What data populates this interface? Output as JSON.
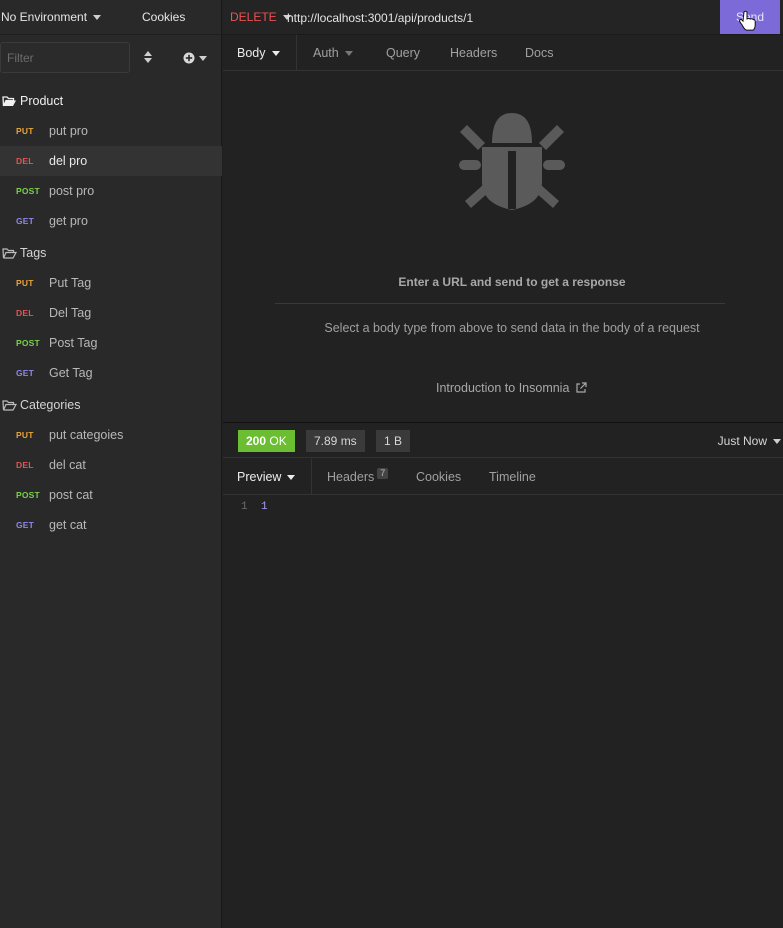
{
  "sidebar": {
    "environment": "No Environment",
    "cookies": "Cookies",
    "filter_placeholder": "Filter",
    "folders": [
      {
        "name": "Product",
        "requests": [
          {
            "method": "PUT",
            "name": "put pro"
          },
          {
            "method": "DEL",
            "name": "del pro"
          },
          {
            "method": "POST",
            "name": "post pro"
          },
          {
            "method": "GET",
            "name": "get pro"
          }
        ]
      },
      {
        "name": "Tags",
        "requests": [
          {
            "method": "PUT",
            "name": "Put Tag"
          },
          {
            "method": "DEL",
            "name": "Del Tag"
          },
          {
            "method": "POST",
            "name": "Post Tag"
          },
          {
            "method": "GET",
            "name": "Get Tag"
          }
        ]
      },
      {
        "name": "Categories",
        "requests": [
          {
            "method": "PUT",
            "name": "put categoies"
          },
          {
            "method": "DEL",
            "name": "del cat"
          },
          {
            "method": "POST",
            "name": "post cat"
          },
          {
            "method": "GET",
            "name": "get cat"
          }
        ]
      }
    ]
  },
  "request": {
    "method": "DELETE",
    "url": "http://localhost:3001/api/products/1",
    "send_label": "Send",
    "tabs": [
      "Body",
      "Auth",
      "Query",
      "Headers",
      "Docs"
    ]
  },
  "empty_state": {
    "title": "Enter a URL and send to get a response",
    "hint": "Select a body type from above to send data in the body of a request",
    "link": "Introduction to Insomnia"
  },
  "response": {
    "status_code": "200",
    "status_text": "OK",
    "time": "7.89 ms",
    "size": "1 B",
    "timestamp": "Just Now",
    "tabs": [
      "Preview",
      "Headers",
      "Cookies",
      "Timeline"
    ],
    "headers_count": "7",
    "body_lines": [
      {
        "line": "1",
        "value": "1"
      }
    ]
  },
  "colors": {
    "accent": "#7b6ad8",
    "put": "#e9a23b",
    "del": "#e85353",
    "post": "#7bd24a",
    "get": "#8f86f0",
    "ok": "#6bbd32"
  }
}
